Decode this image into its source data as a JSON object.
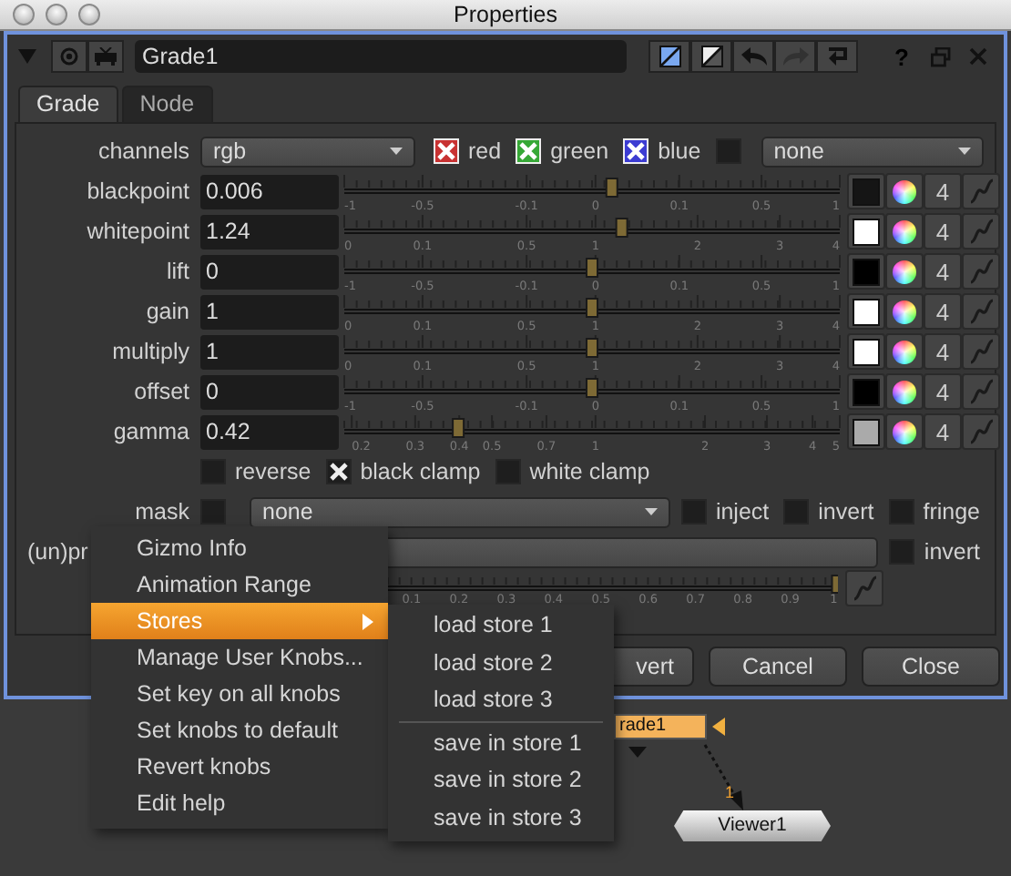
{
  "window": {
    "title": "Properties"
  },
  "header": {
    "name": "Grade1",
    "help": "?",
    "toolbar": [
      {
        "kind": "rgb",
        "disabled": false
      },
      {
        "kind": "bw",
        "disabled": false
      },
      {
        "kind": "undo",
        "disabled": false
      },
      {
        "kind": "redo",
        "disabled": true
      },
      {
        "kind": "revert",
        "disabled": false
      }
    ]
  },
  "tabs": [
    {
      "label": "Grade",
      "selected": true
    },
    {
      "label": "Node",
      "selected": false
    }
  ],
  "channels": {
    "label": "channels",
    "value": "rgb",
    "toggles": [
      {
        "label": "red",
        "checked": true,
        "color": "#c83232"
      },
      {
        "label": "green",
        "checked": true,
        "color": "#36a836"
      },
      {
        "label": "blue",
        "checked": true,
        "color": "#3c3cd2"
      }
    ],
    "extra_checked": false,
    "extra_value": "none"
  },
  "knobs": [
    {
      "label": "blackpoint",
      "value": "0.006",
      "level": 0.54,
      "kind": "signed",
      "ticks": [
        "-1",
        "-0.5",
        "-0.1",
        "0",
        "0.1",
        "0.5",
        "1"
      ],
      "color": "#151515",
      "count": "4"
    },
    {
      "label": "whitepoint",
      "value": "1.24",
      "level": 0.56,
      "kind": "gain",
      "ticks": [
        "0",
        "0.1",
        "0.5",
        "1",
        "2",
        "3",
        "4"
      ],
      "color": "#ffffff",
      "count": "4"
    },
    {
      "label": "lift",
      "value": "0",
      "level": 0.5,
      "kind": "signed",
      "ticks": [
        "-1",
        "-0.5",
        "-0.1",
        "0",
        "0.1",
        "0.5",
        "1"
      ],
      "color": "#000000",
      "count": "4"
    },
    {
      "label": "gain",
      "value": "1",
      "level": 0.5,
      "kind": "gain",
      "ticks": [
        "0",
        "0.1",
        "0.5",
        "1",
        "2",
        "3",
        "4"
      ],
      "color": "#ffffff",
      "count": "4"
    },
    {
      "label": "multiply",
      "value": "1",
      "level": 0.5,
      "kind": "gain",
      "ticks": [
        "0",
        "0.1",
        "0.5",
        "1",
        "2",
        "3",
        "4"
      ],
      "color": "#ffffff",
      "count": "4"
    },
    {
      "label": "offset",
      "value": "0",
      "level": 0.5,
      "kind": "signed",
      "ticks": [
        "-1",
        "-0.5",
        "-0.1",
        "0",
        "0.1",
        "0.5",
        "1"
      ],
      "color": "#000000",
      "count": "4"
    },
    {
      "label": "gamma",
      "value": "0.42",
      "level": 0.23,
      "kind": "gamma",
      "ticks": [
        "0.2",
        "0.3",
        "0.4",
        "0.5",
        "0.7",
        "1",
        "2",
        "3",
        "4",
        "5"
      ],
      "color": "#aaaaaa",
      "count": "4"
    }
  ],
  "clamps": [
    {
      "label": "reverse",
      "checked": false
    },
    {
      "label": "black clamp",
      "checked": true
    },
    {
      "label": "white clamp",
      "checked": false
    }
  ],
  "mask": {
    "label": "mask",
    "checked": false,
    "value": "none",
    "options": [
      {
        "label": "inject",
        "checked": false
      },
      {
        "label": "invert",
        "checked": false
      },
      {
        "label": "fringe",
        "checked": false
      }
    ]
  },
  "premult": {
    "label": "(un)pr",
    "invert": {
      "label": "invert",
      "checked": false
    }
  },
  "mix": {
    "level": 1,
    "kind": "mix",
    "ticks": [
      "0.1",
      "0.2",
      "0.3",
      "0.4",
      "0.5",
      "0.6",
      "0.7",
      "0.8",
      "0.9",
      "1"
    ]
  },
  "buttons": [
    {
      "label": "vert"
    },
    {
      "label": "Cancel"
    },
    {
      "label": "Close"
    }
  ],
  "context_menu": {
    "items": [
      {
        "label": "Gizmo Info",
        "selected": false,
        "submenu": false
      },
      {
        "label": "Animation Range",
        "selected": false,
        "submenu": false
      },
      {
        "label": "Stores",
        "selected": true,
        "submenu": true
      },
      {
        "label": "Manage User Knobs...",
        "selected": false,
        "submenu": false
      },
      {
        "label": "Set key on all knobs",
        "selected": false,
        "submenu": false
      },
      {
        "label": "Set knobs to default",
        "selected": false,
        "submenu": false
      },
      {
        "label": "Revert knobs",
        "selected": false,
        "submenu": false
      },
      {
        "label": "Edit help",
        "selected": false,
        "submenu": false
      }
    ]
  },
  "submenu": {
    "groups": [
      [
        "load store 1",
        "load store 2",
        "load store 3"
      ],
      [
        "save in store 1",
        "save in store 2",
        "save in store 3"
      ]
    ]
  },
  "node_graph": {
    "nodes": [
      {
        "label": "rade1",
        "kind": "grade"
      },
      {
        "label": "Viewer1",
        "kind": "viewer"
      }
    ],
    "edge_label": "1"
  }
}
